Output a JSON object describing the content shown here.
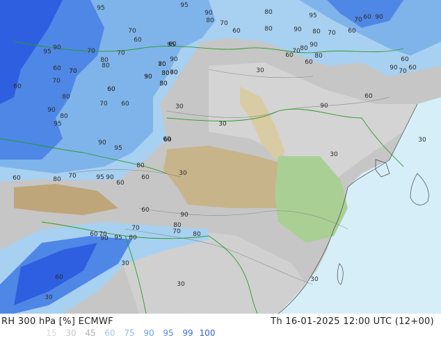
{
  "map": {
    "colors": {
      "ocean": "#d6eef8",
      "land_dry": "#c2c2c2",
      "land_mid": "#d2d2d2",
      "desert": "#c8b48a",
      "terrain_green": "#a9cf95",
      "rh_70": "#a8d0f0",
      "rh_80": "#7fb4ea",
      "rh_90": "#4f87e6",
      "rh_95": "#2e5fe0",
      "border": "#2a9a2a",
      "contour": "#6a6a6a"
    },
    "contour_labels": [
      "95",
      "95",
      "90",
      "80",
      "95",
      "70",
      "60",
      "90",
      "80",
      "70",
      "60",
      "80",
      "90",
      "80",
      "70",
      "60",
      "70",
      "60",
      "60",
      "70",
      "80",
      "90",
      "80",
      "60",
      "95",
      "90",
      "70",
      "80",
      "70",
      "95",
      "90",
      "60",
      "70",
      "80",
      "60",
      "80",
      "70",
      "80",
      "90",
      "30",
      "60",
      "90",
      "70",
      "60",
      "60",
      "70",
      "80",
      "60",
      "80",
      "90",
      "60",
      "30",
      "30",
      "90",
      "95",
      "80",
      "70",
      "60",
      "30",
      "30",
      "60",
      "60",
      "60",
      "90",
      "95",
      "90",
      "95",
      "80",
      "70",
      "60",
      "30",
      "60",
      "90",
      "80",
      "70",
      "95",
      "90",
      "80",
      "70",
      "60",
      "30",
      "30",
      "30",
      "30",
      "80",
      "60",
      "70",
      "80",
      "60",
      "70",
      "30",
      "60",
      "70",
      "60",
      "30",
      "30",
      "30",
      "30"
    ]
  },
  "footer": {
    "title": "RH 300 hPa [%] ECMWF",
    "date": "Th 16-01-2025 12:00 UTC (12+00)",
    "legend": [
      {
        "label": "15",
        "color": "#d9d9d9"
      },
      {
        "label": "30",
        "color": "#c4c4c4"
      },
      {
        "label": "45",
        "color": "#b0b0b0"
      },
      {
        "label": "60",
        "color": "#9ec9f0"
      },
      {
        "label": "75",
        "color": "#86b9ec"
      },
      {
        "label": "90",
        "color": "#6aa2e8"
      },
      {
        "label": "95",
        "color": "#4f87e6"
      },
      {
        "label": "99",
        "color": "#3a6ee3"
      },
      {
        "label": "100",
        "color": "#2e5fe0"
      }
    ]
  }
}
